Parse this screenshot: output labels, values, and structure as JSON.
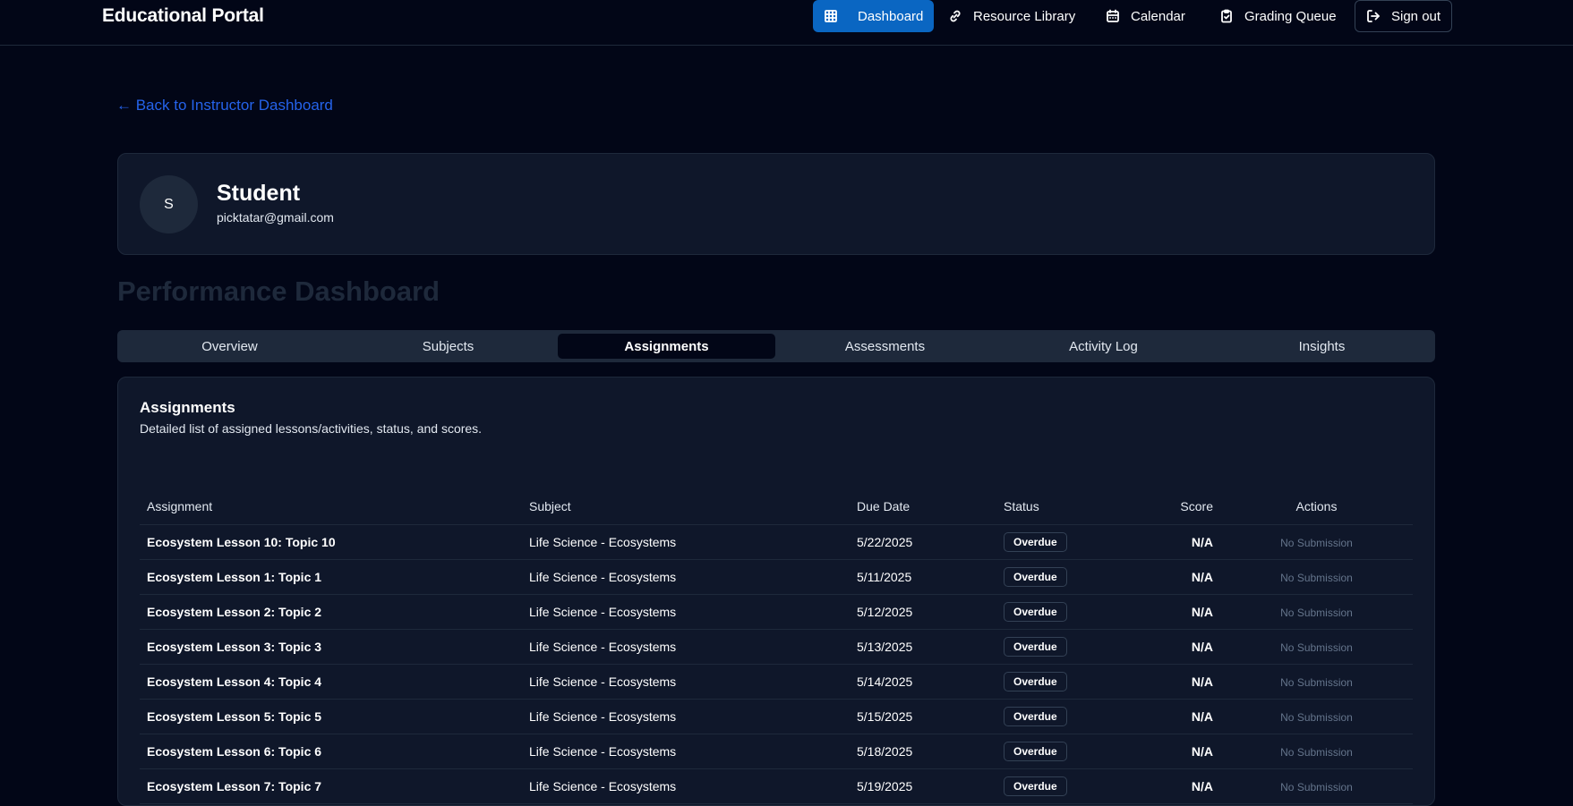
{
  "app": {
    "title": "Educational Portal"
  },
  "nav": [
    {
      "label": "Dashboard",
      "icon": "grid-icon",
      "active": true
    },
    {
      "label": "Resource Library",
      "icon": "link-icon",
      "active": false
    },
    {
      "label": "Calendar",
      "icon": "calendar-icon",
      "active": false
    },
    {
      "label": "Grading Queue",
      "icon": "clipboard-check-icon",
      "active": false
    },
    {
      "label": "Sign out",
      "icon": "sign-out-icon",
      "active": false
    }
  ],
  "back_link": "← Back to Instructor Dashboard",
  "profile": {
    "initial": "S",
    "name": "Student",
    "email": "picktatar@gmail.com"
  },
  "page_title": "Performance Dashboard",
  "tabs": [
    {
      "label": "Overview",
      "active": false
    },
    {
      "label": "Subjects",
      "active": false
    },
    {
      "label": "Assignments",
      "active": true
    },
    {
      "label": "Assessments",
      "active": false
    },
    {
      "label": "Activity Log",
      "active": false
    },
    {
      "label": "Insights",
      "active": false
    }
  ],
  "assignments": {
    "title": "Assignments",
    "description": "Detailed list of assigned lessons/activities, status, and scores.",
    "columns": [
      "Assignment",
      "Subject",
      "Due Date",
      "Status",
      "Score",
      "Actions"
    ],
    "rows": [
      {
        "assignment": "Ecosystem Lesson 10: Topic 10",
        "subject": "Life Science - Ecosystems",
        "due": "5/22/2025",
        "status": "Overdue",
        "score": "N/A",
        "action": "No Submission"
      },
      {
        "assignment": "Ecosystem Lesson 1: Topic 1",
        "subject": "Life Science - Ecosystems",
        "due": "5/11/2025",
        "status": "Overdue",
        "score": "N/A",
        "action": "No Submission"
      },
      {
        "assignment": "Ecosystem Lesson 2: Topic 2",
        "subject": "Life Science - Ecosystems",
        "due": "5/12/2025",
        "status": "Overdue",
        "score": "N/A",
        "action": "No Submission"
      },
      {
        "assignment": "Ecosystem Lesson 3: Topic 3",
        "subject": "Life Science - Ecosystems",
        "due": "5/13/2025",
        "status": "Overdue",
        "score": "N/A",
        "action": "No Submission"
      },
      {
        "assignment": "Ecosystem Lesson 4: Topic 4",
        "subject": "Life Science - Ecosystems",
        "due": "5/14/2025",
        "status": "Overdue",
        "score": "N/A",
        "action": "No Submission"
      },
      {
        "assignment": "Ecosystem Lesson 5: Topic 5",
        "subject": "Life Science - Ecosystems",
        "due": "5/15/2025",
        "status": "Overdue",
        "score": "N/A",
        "action": "No Submission"
      },
      {
        "assignment": "Ecosystem Lesson 6: Topic 6",
        "subject": "Life Science - Ecosystems",
        "due": "5/18/2025",
        "status": "Overdue",
        "score": "N/A",
        "action": "No Submission"
      },
      {
        "assignment": "Ecosystem Lesson 7: Topic 7",
        "subject": "Life Science - Ecosystems",
        "due": "5/19/2025",
        "status": "Overdue",
        "score": "N/A",
        "action": "No Submission"
      }
    ]
  },
  "colors": {
    "accent": "#0a66c2",
    "link": "#2563eb",
    "background": "#020617",
    "card": "#0f172a"
  }
}
